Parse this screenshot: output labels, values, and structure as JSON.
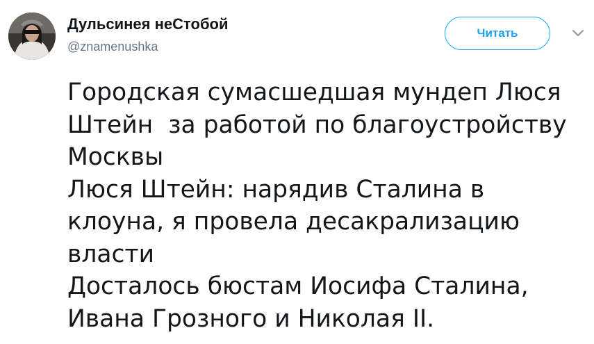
{
  "author": {
    "display_name": "Дульсинея неСтобой",
    "handle": "@znamenushka"
  },
  "follow_button": {
    "label": "Читать"
  },
  "icons": {
    "avatar": "user-avatar-photo",
    "more": "chevron-down-icon"
  },
  "colors": {
    "accent": "#1da1f2",
    "text": "#14171a",
    "secondary_text": "#657786"
  },
  "tweet": {
    "lines": [
      "Городская сумасшедшая мундеп Люся",
      "Штейн  за работой по благоустройству",
      "Москвы",
      "Люся Штейн: нарядив Сталина в",
      "клоуна, я провела десакрализацию",
      "власти",
      "Досталось бюстам Иосифа Сталина,",
      "Ивана Грозного и Николая II."
    ]
  }
}
